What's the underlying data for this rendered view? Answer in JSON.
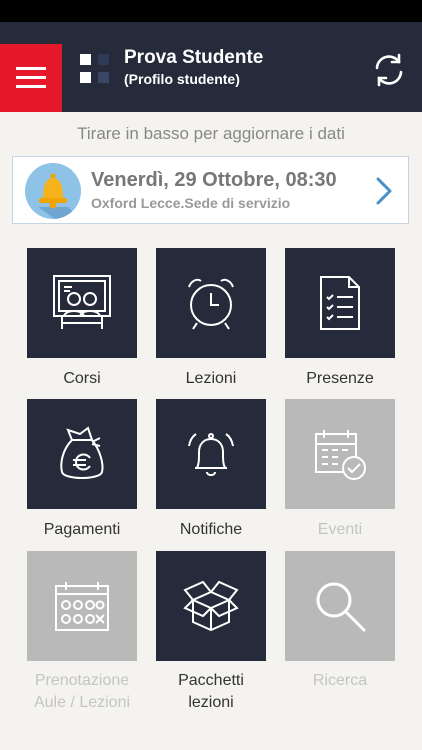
{
  "header": {
    "title": "Prova Studente",
    "subtitle": "(Profilo studente)"
  },
  "pull_hint": "Tirare in basso per aggiornare i dati",
  "event": {
    "date": "Venerdì, 29 Ottobre, 08:30",
    "place": "Oxford Lecce.Sede di servizio"
  },
  "tiles": [
    {
      "label": "Corsi",
      "icon": "classroom-icon",
      "enabled": true
    },
    {
      "label": "Lezioni",
      "icon": "alarm-clock-icon",
      "enabled": true
    },
    {
      "label": "Presenze",
      "icon": "checklist-icon",
      "enabled": true
    },
    {
      "label": "Pagamenti",
      "icon": "money-bag-icon",
      "enabled": true
    },
    {
      "label": "Notifiche",
      "icon": "bell-icon",
      "enabled": true
    },
    {
      "label": "Eventi",
      "icon": "calendar-check-icon",
      "enabled": false
    },
    {
      "label_line1": "Prenotazione",
      "label_line2": "Aule / Lezioni",
      "icon": "booking-calendar-icon",
      "enabled": false
    },
    {
      "label_line1": "Pacchetti",
      "label_line2": "lezioni",
      "icon": "package-icon",
      "enabled": true
    },
    {
      "label": "Ricerca",
      "icon": "search-icon",
      "enabled": false
    }
  ],
  "colors": {
    "navbar": "#252b3a",
    "accent_red": "#e5192a",
    "tile_enabled": "#252b3a",
    "tile_disabled": "#b9b9b9",
    "link_blue": "#4a90c8"
  }
}
